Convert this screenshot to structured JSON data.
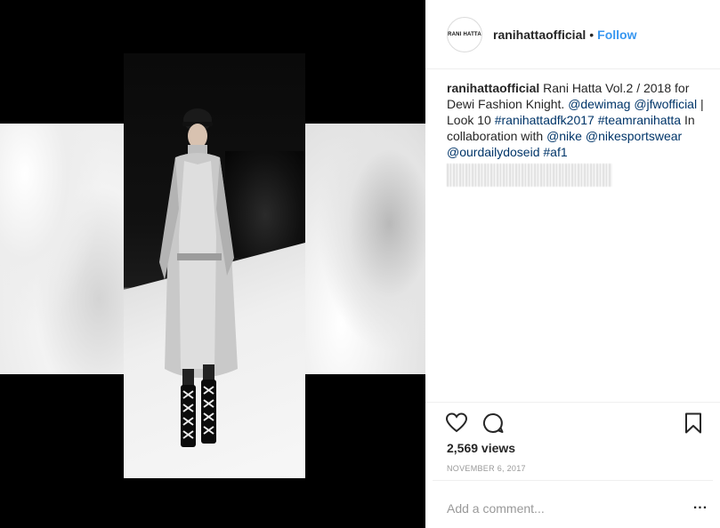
{
  "header": {
    "avatar_text": "RANI HATTA",
    "username": "ranihattaofficial",
    "separator": "•",
    "follow_label": "Follow"
  },
  "caption": {
    "username": "ranihattaofficial",
    "text_1": " Rani Hatta Vol.2 / 2018 for Dewi Fashion Knight. ",
    "mention_1": "@dewimag",
    "mention_2": "@jfwofficial",
    "text_2": " | Look 10 ",
    "hashtag_1": "#ranihattadfk2017",
    "hashtag_2": "#teamranihatta",
    "text_3": " In collaboration with ",
    "mention_3": "@nike",
    "mention_4": "@nikesportswear",
    "mention_5": "@ourdailydoseid",
    "hashtag_3": "#af1"
  },
  "actions": {
    "like_icon": "heart-icon",
    "comment_icon": "comment-bubble-icon",
    "save_icon": "bookmark-icon"
  },
  "stats": {
    "views": "2,569 views",
    "date": "NOVEMBER 6, 2017"
  },
  "comment": {
    "placeholder": "Add a comment...",
    "more_label": "..."
  },
  "colors": {
    "accent": "#3897f0",
    "link": "#003569",
    "muted": "#999999",
    "text": "#262626"
  }
}
